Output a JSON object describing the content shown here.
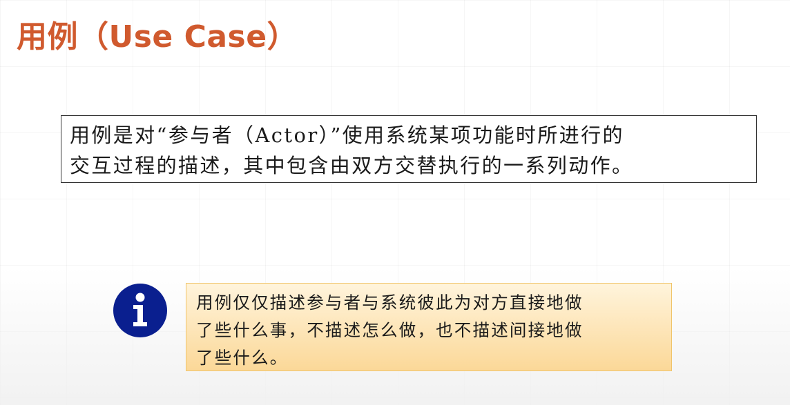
{
  "slide": {
    "title": "用例（Use Case）"
  },
  "definition": {
    "text": "用例是对“参与者（Actor）”使用系统某项功能时所进行的\n交互过程的描述，其中包含由双方交替执行的一系列动作。"
  },
  "note": {
    "icon": "info-icon",
    "text": "用例仅仅描述参与者与系统彼此为对方直接地做\n了些什么事，不描述怎么做，也不描述间接地做\n了些什么。"
  },
  "colors": {
    "title": "#d05a2e",
    "info_icon": "#0a1f8f",
    "note_border": "#f0c46a",
    "note_fill_top": "#fff4dc",
    "note_fill_bottom": "#fbd898"
  }
}
